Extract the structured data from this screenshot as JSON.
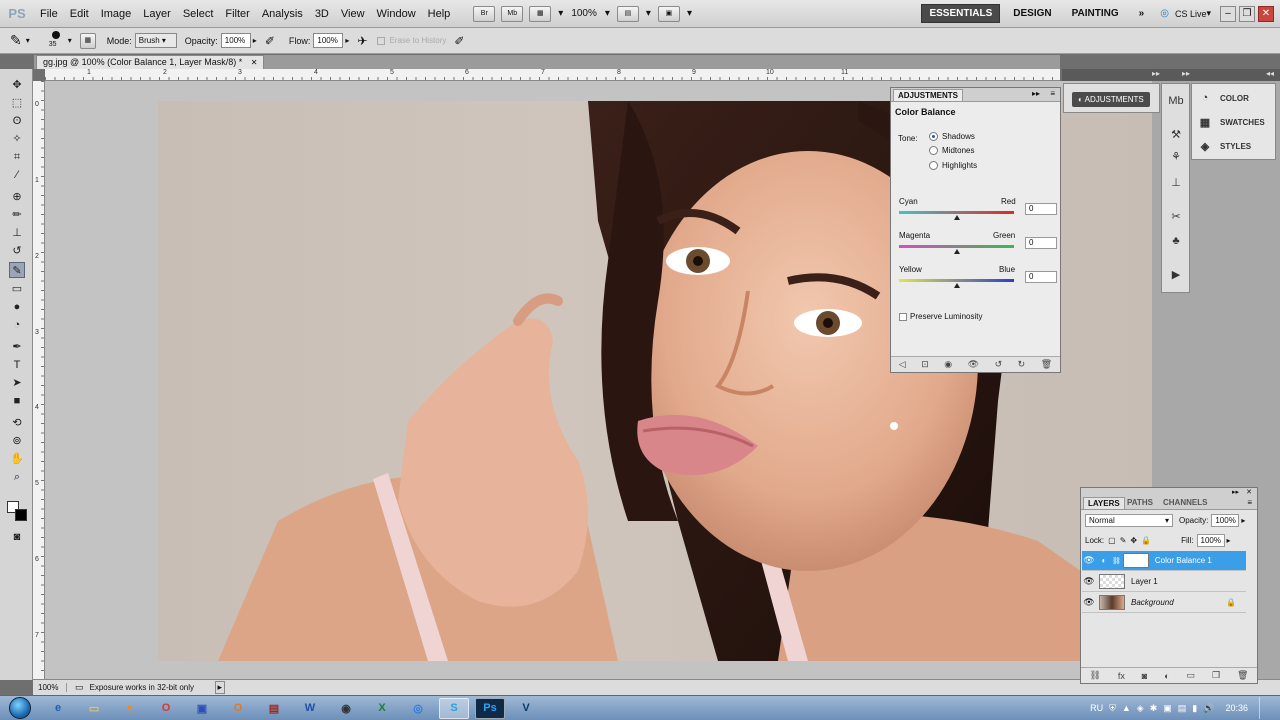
{
  "app": {
    "logo": "PS"
  },
  "menu": [
    "File",
    "Edit",
    "Image",
    "Layer",
    "Select",
    "Filter",
    "Analysis",
    "3D",
    "View",
    "Window",
    "Help"
  ],
  "appbar": {
    "bridge": "Br",
    "minibridge": "Mb",
    "zoom": "100%",
    "workspaces": [
      "ESSENTIALS",
      "DESIGN",
      "PAINTING"
    ],
    "more": "»",
    "cslive": "CS Live"
  },
  "options": {
    "brush_size": "35",
    "mode_label": "Mode:",
    "mode_value": "Brush",
    "opacity_label": "Opacity:",
    "opacity_value": "100%",
    "flow_label": "Flow:",
    "flow_value": "100%",
    "erase_history": "Erase to History"
  },
  "document": {
    "tab_title": "gg.jpg @ 100% (Color Balance 1, Layer Mask/8) *"
  },
  "ruler": {
    "h": [
      "1",
      "2",
      "3",
      "4",
      "5",
      "6",
      "7",
      "8",
      "9",
      "10",
      "11"
    ],
    "v": [
      "0",
      "1",
      "2",
      "3",
      "4",
      "5",
      "6",
      "7"
    ]
  },
  "status": {
    "zoom": "100%",
    "message": "Exposure works in 32-bit only"
  },
  "dock": {
    "adjustments_label": "ADJUSTMENTS",
    "color": "COLOR",
    "swatches": "SWATCHES",
    "styles": "STYLES"
  },
  "adjustments": {
    "tab": "ADJUSTMENTS",
    "title": "Color Balance",
    "tone_label": "Tone:",
    "tones": [
      "Shadows",
      "Midtones",
      "Highlights"
    ],
    "selected_tone": "Shadows",
    "sliders": [
      {
        "left": "Cyan",
        "right": "Red",
        "value": "0",
        "pos": 0.5,
        "left_color": "#3fc6c4",
        "right_color": "#e2262b"
      },
      {
        "left": "Magenta",
        "right": "Green",
        "value": "0",
        "pos": 0.5,
        "left_color": "#d44cc7",
        "right_color": "#3bb94a"
      },
      {
        "left": "Yellow",
        "right": "Blue",
        "value": "0",
        "pos": 0.5,
        "left_color": "#e6e34a",
        "right_color": "#2b3fc8"
      }
    ],
    "preserve": "Preserve Luminosity"
  },
  "layers": {
    "tabs": [
      "LAYERS",
      "PATHS",
      "CHANNELS"
    ],
    "blend": "Normal",
    "opacity_label": "Opacity:",
    "opacity": "100%",
    "lock_label": "Lock:",
    "fill_label": "Fill:",
    "fill": "100%",
    "items": [
      {
        "name": "Color Balance 1",
        "selected": true
      },
      {
        "name": "Layer 1",
        "selected": false
      },
      {
        "name": "Background",
        "selected": false
      }
    ]
  },
  "taskbar": {
    "lang": "RU",
    "time": "20:36"
  },
  "colors": {
    "layer_selected": "#3a9ee8",
    "workspace_active": "#4a4a4a"
  }
}
